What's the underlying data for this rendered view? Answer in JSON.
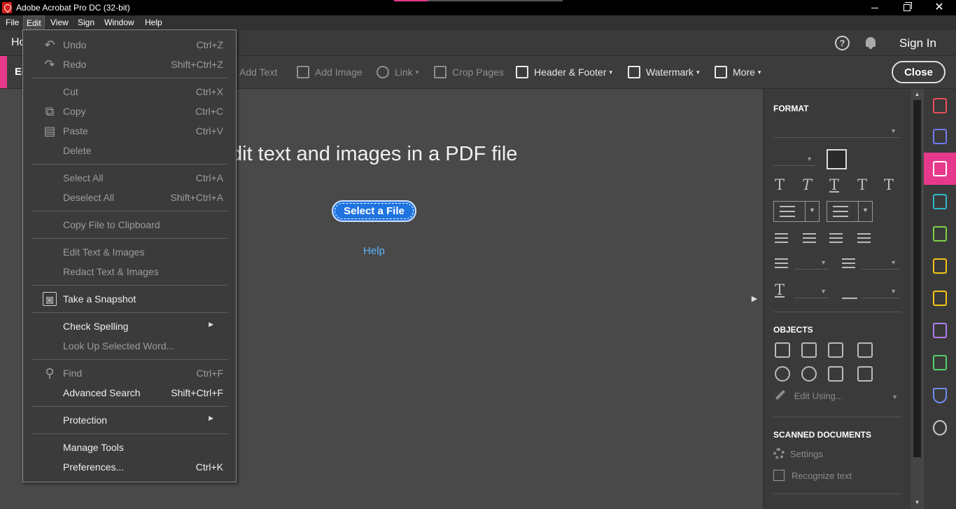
{
  "window": {
    "title": "Adobe Acrobat Pro DC (32-bit)",
    "controls": {
      "minimize": "minimize-icon",
      "maximize": "restore-icon",
      "close": "✕"
    }
  },
  "menubar": {
    "items": [
      "File",
      "Edit",
      "View",
      "Sign",
      "Window",
      "Help"
    ],
    "active": "Edit"
  },
  "topnav": {
    "home_tab": "Ho",
    "sign_in": "Sign In",
    "help_glyph": "?"
  },
  "toolbar": {
    "title": "Ed",
    "tools": [
      {
        "label": "Add Text",
        "icon": "add-text-icon",
        "enabled": false,
        "dropdown": false
      },
      {
        "label": "Add Image",
        "icon": "add-image-icon",
        "enabled": false,
        "dropdown": false
      },
      {
        "label": "Link",
        "icon": "link-icon",
        "enabled": false,
        "dropdown": true
      },
      {
        "label": "Crop Pages",
        "icon": "crop-pages-icon",
        "enabled": false,
        "dropdown": false
      },
      {
        "label": "Header & Footer",
        "icon": "header-footer-icon",
        "enabled": true,
        "dropdown": true
      },
      {
        "label": "Watermark",
        "icon": "watermark-icon",
        "enabled": true,
        "dropdown": true
      },
      {
        "label": "More",
        "icon": "more-icon",
        "enabled": true,
        "dropdown": true
      }
    ],
    "close_label": "Close",
    "caret": "▾"
  },
  "document": {
    "heading": "dit text and images in a PDF file",
    "select_button": "Select a File",
    "help_link": "Help",
    "collapse_glyph": "▶"
  },
  "format_panel": {
    "format_title": "FORMAT",
    "objects_title": "OBJECTS",
    "scanned_title": "SCANNED DOCUMENTS",
    "edit_using": "Edit Using...",
    "settings": "Settings",
    "recognize_text": "Recognize text",
    "text_styles": [
      "T",
      "T",
      "T",
      "T",
      "T"
    ],
    "dropdown_caret": "▼"
  },
  "scrollbar": {
    "up": "▲",
    "down": "▼"
  },
  "right_rail": {
    "icons": [
      {
        "name": "create-pdf-icon",
        "color": "#e8505b"
      },
      {
        "name": "export-pdf-icon",
        "color": "#6f7cf0"
      },
      {
        "name": "edit-pdf-icon",
        "color": "#ffffff",
        "active": true
      },
      {
        "name": "combine-files-icon",
        "color": "#2fb8c9"
      },
      {
        "name": "organize-pages-icon",
        "color": "#7fd14b"
      },
      {
        "name": "send-comments-icon",
        "color": "#f5c518"
      },
      {
        "name": "comment-icon",
        "color": "#f5c518"
      },
      {
        "name": "fill-sign-icon",
        "color": "#b07cf0"
      },
      {
        "name": "print-production-icon",
        "color": "#55d16b"
      },
      {
        "name": "protect-icon",
        "color": "#6f8cf0"
      },
      {
        "name": "more-tools-icon",
        "color": "#cccccc"
      }
    ],
    "accent": "#e6398c"
  },
  "edit_menu": {
    "items": [
      {
        "label": "Undo",
        "shortcut": "Ctrl+Z",
        "enabled": false,
        "icon": "undo-icon",
        "glyph": "↶"
      },
      {
        "label": "Redo",
        "shortcut": "Shift+Ctrl+Z",
        "enabled": false,
        "icon": "redo-icon",
        "glyph": "↷"
      },
      {
        "label": "Cut",
        "shortcut": "Ctrl+X",
        "enabled": false
      },
      {
        "label": "Copy",
        "shortcut": "Ctrl+C",
        "enabled": false,
        "icon": "copy-icon",
        "glyph": "⧉"
      },
      {
        "label": "Paste",
        "shortcut": "Ctrl+V",
        "enabled": false,
        "icon": "paste-icon",
        "glyph": "▤"
      },
      {
        "label": "Delete",
        "shortcut": "",
        "enabled": false
      },
      {
        "label": "Select All",
        "shortcut": "Ctrl+A",
        "enabled": false
      },
      {
        "label": "Deselect All",
        "shortcut": "Shift+Ctrl+A",
        "enabled": false
      },
      {
        "label": "Copy File to Clipboard",
        "shortcut": "",
        "enabled": false
      },
      {
        "label": "Edit Text & Images",
        "shortcut": "",
        "enabled": false
      },
      {
        "label": "Redact Text & Images",
        "shortcut": "",
        "enabled": false
      },
      {
        "label": "Take a Snapshot",
        "shortcut": "",
        "enabled": true,
        "icon": "camera-icon",
        "glyph": "◙"
      },
      {
        "label": "Check Spelling",
        "shortcut": "",
        "enabled": true,
        "submenu": true
      },
      {
        "label": "Look Up Selected Word...",
        "shortcut": "",
        "enabled": false
      },
      {
        "label": "Find",
        "shortcut": "Ctrl+F",
        "enabled": false,
        "icon": "search-icon",
        "glyph": "⚲"
      },
      {
        "label": "Advanced Search",
        "shortcut": "Shift+Ctrl+F",
        "enabled": true
      },
      {
        "label": "Protection",
        "shortcut": "",
        "enabled": true,
        "submenu": true
      },
      {
        "label": "Manage Tools",
        "shortcut": "",
        "enabled": true
      },
      {
        "label": "Preferences...",
        "shortcut": "Ctrl+K",
        "enabled": true
      }
    ],
    "submenu_glyph": "▶"
  }
}
